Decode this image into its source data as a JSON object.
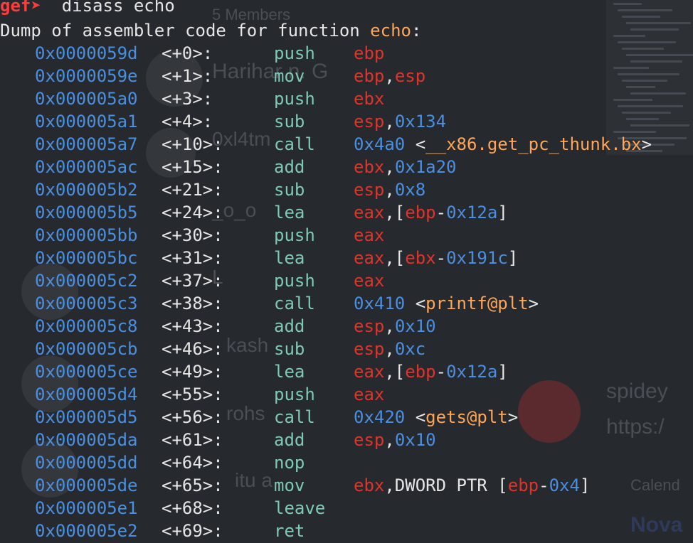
{
  "prompt": {
    "symbol": "gef➤",
    "command": "disass echo"
  },
  "header": {
    "prefix": "Dump of assembler code for function ",
    "function": "echo",
    "suffix": ":"
  },
  "colors": {
    "background": "#262a2e",
    "prompt": "#ff3b3b",
    "address": "#4a8fe0",
    "mnemonic": "#7ec9b8",
    "register": "#e0332b",
    "number": "#4a8fe0",
    "symbol": "#ffa657",
    "text": "#e6e6e6"
  },
  "background_window": {
    "texts": [
      "5 Members",
      "Harihar n. G",
      "0xl4tm",
      "_o_o",
      "L",
      "kash",
      "rohs",
      "itu a",
      "spidey",
      "https:/",
      "Calend",
      "Nova"
    ]
  },
  "instructions": [
    {
      "address": "0x0000059d",
      "offset": "<+0>:",
      "mnemonic": "push",
      "operands": [
        [
          "reg",
          "ebp"
        ]
      ]
    },
    {
      "address": "0x0000059e",
      "offset": "<+1>:",
      "mnemonic": "mov",
      "operands": [
        [
          "reg",
          "ebp"
        ],
        [
          "plain",
          ","
        ],
        [
          "reg",
          "esp"
        ]
      ]
    },
    {
      "address": "0x000005a0",
      "offset": "<+3>:",
      "mnemonic": "push",
      "operands": [
        [
          "reg",
          "ebx"
        ]
      ]
    },
    {
      "address": "0x000005a1",
      "offset": "<+4>:",
      "mnemonic": "sub",
      "operands": [
        [
          "reg",
          "esp"
        ],
        [
          "plain",
          ","
        ],
        [
          "num",
          "0x134"
        ]
      ]
    },
    {
      "address": "0x000005a7",
      "offset": "<+10>:",
      "mnemonic": "call",
      "operands": [
        [
          "num",
          "0x4a0"
        ],
        [
          "plain",
          " <"
        ],
        [
          "sym",
          "__x86.get_pc_thunk.bx"
        ],
        [
          "plain",
          ">"
        ]
      ]
    },
    {
      "address": "0x000005ac",
      "offset": "<+15>:",
      "mnemonic": "add",
      "operands": [
        [
          "reg",
          "ebx"
        ],
        [
          "plain",
          ","
        ],
        [
          "num",
          "0x1a20"
        ]
      ]
    },
    {
      "address": "0x000005b2",
      "offset": "<+21>:",
      "mnemonic": "sub",
      "operands": [
        [
          "reg",
          "esp"
        ],
        [
          "plain",
          ","
        ],
        [
          "num",
          "0x8"
        ]
      ]
    },
    {
      "address": "0x000005b5",
      "offset": "<+24>:",
      "mnemonic": "lea",
      "operands": [
        [
          "reg",
          "eax"
        ],
        [
          "plain",
          ",["
        ],
        [
          "reg",
          "ebp"
        ],
        [
          "plain",
          "-"
        ],
        [
          "num",
          "0x12a"
        ],
        [
          "plain",
          "]"
        ]
      ]
    },
    {
      "address": "0x000005bb",
      "offset": "<+30>:",
      "mnemonic": "push",
      "operands": [
        [
          "reg",
          "eax"
        ]
      ]
    },
    {
      "address": "0x000005bc",
      "offset": "<+31>:",
      "mnemonic": "lea",
      "operands": [
        [
          "reg",
          "eax"
        ],
        [
          "plain",
          ",["
        ],
        [
          "reg",
          "ebx"
        ],
        [
          "plain",
          "-"
        ],
        [
          "num",
          "0x191c"
        ],
        [
          "plain",
          "]"
        ]
      ]
    },
    {
      "address": "0x000005c2",
      "offset": "<+37>:",
      "mnemonic": "push",
      "operands": [
        [
          "reg",
          "eax"
        ]
      ]
    },
    {
      "address": "0x000005c3",
      "offset": "<+38>:",
      "mnemonic": "call",
      "operands": [
        [
          "num",
          "0x410"
        ],
        [
          "plain",
          " <"
        ],
        [
          "sym",
          "printf@plt"
        ],
        [
          "plain",
          ">"
        ]
      ]
    },
    {
      "address": "0x000005c8",
      "offset": "<+43>:",
      "mnemonic": "add",
      "operands": [
        [
          "reg",
          "esp"
        ],
        [
          "plain",
          ","
        ],
        [
          "num",
          "0x10"
        ]
      ]
    },
    {
      "address": "0x000005cb",
      "offset": "<+46>:",
      "mnemonic": "sub",
      "operands": [
        [
          "reg",
          "esp"
        ],
        [
          "plain",
          ","
        ],
        [
          "num",
          "0xc"
        ]
      ]
    },
    {
      "address": "0x000005ce",
      "offset": "<+49>:",
      "mnemonic": "lea",
      "operands": [
        [
          "reg",
          "eax"
        ],
        [
          "plain",
          ",["
        ],
        [
          "reg",
          "ebp"
        ],
        [
          "plain",
          "-"
        ],
        [
          "num",
          "0x12a"
        ],
        [
          "plain",
          "]"
        ]
      ]
    },
    {
      "address": "0x000005d4",
      "offset": "<+55>:",
      "mnemonic": "push",
      "operands": [
        [
          "reg",
          "eax"
        ]
      ]
    },
    {
      "address": "0x000005d5",
      "offset": "<+56>:",
      "mnemonic": "call",
      "operands": [
        [
          "num",
          "0x420"
        ],
        [
          "plain",
          " <"
        ],
        [
          "sym",
          "gets@plt"
        ],
        [
          "plain",
          ">"
        ]
      ]
    },
    {
      "address": "0x000005da",
      "offset": "<+61>:",
      "mnemonic": "add",
      "operands": [
        [
          "reg",
          "esp"
        ],
        [
          "plain",
          ","
        ],
        [
          "num",
          "0x10"
        ]
      ]
    },
    {
      "address": "0x000005dd",
      "offset": "<+64>:",
      "mnemonic": "nop",
      "operands": []
    },
    {
      "address": "0x000005de",
      "offset": "<+65>:",
      "mnemonic": "mov",
      "operands": [
        [
          "reg",
          "ebx"
        ],
        [
          "plain",
          ",DWORD PTR ["
        ],
        [
          "reg",
          "ebp"
        ],
        [
          "plain",
          "-"
        ],
        [
          "num",
          "0x4"
        ],
        [
          "plain",
          "]"
        ]
      ]
    },
    {
      "address": "0x000005e1",
      "offset": "<+68>:",
      "mnemonic": "leave",
      "operands": []
    },
    {
      "address": "0x000005e2",
      "offset": "<+69>:",
      "mnemonic": "ret",
      "operands": []
    }
  ]
}
